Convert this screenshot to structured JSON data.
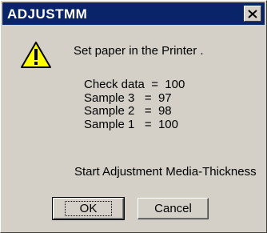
{
  "window": {
    "title": "ADJUSTMM",
    "close_icon": "close-icon"
  },
  "dialog": {
    "icon": "warning-icon",
    "message": "Set paper in the Printer .",
    "lines": [
      "Check data  =  100",
      "Sample 3   =  97",
      "Sample 2   =  98",
      "Sample 1   =  100"
    ],
    "footer": "Start Adjustment Media-Thickness"
  },
  "buttons": {
    "ok_label": "OK",
    "cancel_label": "Cancel"
  },
  "colors": {
    "titlebar": "#0a246a",
    "warning_fill": "#ffff00"
  }
}
